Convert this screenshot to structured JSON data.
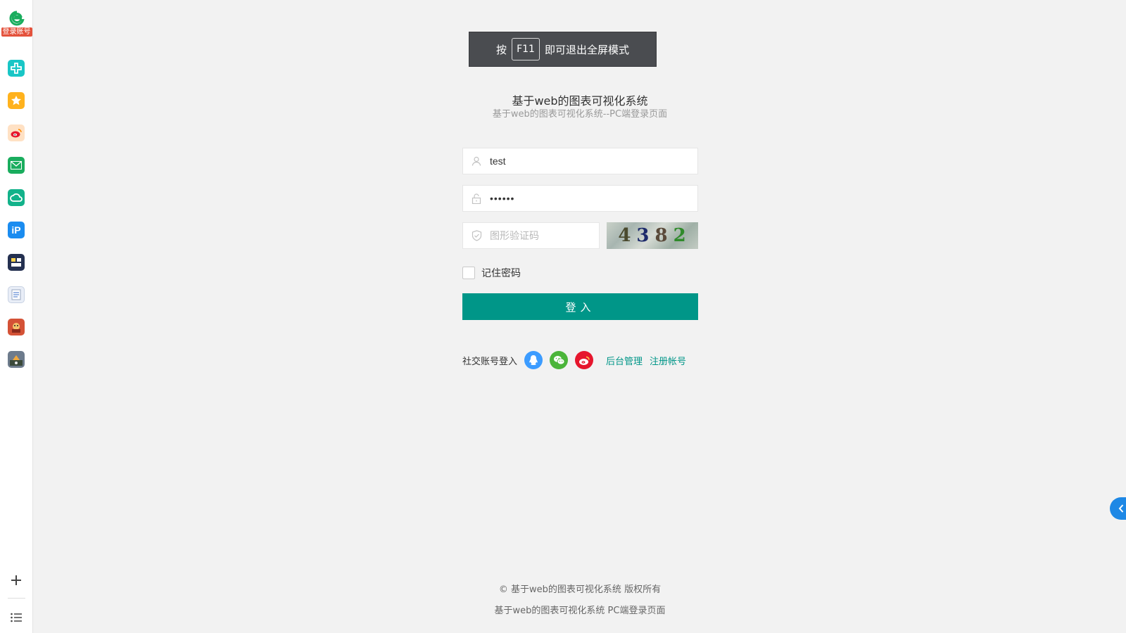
{
  "sidebar": {
    "logo_tag": "登录账号",
    "apps": [
      {
        "icon": "plus-cross-app-icon",
        "color": "#19c6c6"
      },
      {
        "icon": "star-app-icon",
        "color": "#ffb21d"
      },
      {
        "icon": "weibo-app-icon",
        "color": "#ff8a3d"
      },
      {
        "icon": "mail-app-icon",
        "color": "#1aad5e"
      },
      {
        "icon": "cloud-app-icon",
        "color": "#12b28a"
      },
      {
        "icon": "ip-app-icon",
        "color": "#1a8cf0"
      },
      {
        "icon": "news-app-icon",
        "color": "#243050"
      },
      {
        "icon": "word-doc-app-icon",
        "color": "#e9eef7"
      },
      {
        "icon": "game-app-icon",
        "color": "#d45236"
      },
      {
        "icon": "strategy-game-app-icon",
        "color": "#6d7b8c"
      }
    ],
    "add_icon": "plus-icon",
    "menu_icon": "list-icon"
  },
  "fullscreen_hint": {
    "prefix": "按",
    "key": "F11",
    "suffix": "即可退出全屏模式"
  },
  "header": {
    "title": "基于web的图表可视化系统",
    "subtitle": "基于web的图表可视化系统--PC端登录页面"
  },
  "form": {
    "username_value": "test",
    "password_value": "••••••",
    "captcha_placeholder": "图形验证码",
    "captcha_text": [
      "4",
      "3",
      "8",
      "2"
    ],
    "remember_label": "记住密码",
    "login_label": "登入"
  },
  "social": {
    "label": "社交账号登入",
    "admin_link": "后台管理",
    "register_link": "注册帐号"
  },
  "footer": {
    "copyright": "© 基于web的图表可视化系统 版权所有",
    "line2": "基于web的图表可视化系统 PC端登录页面"
  },
  "colors": {
    "accent": "#009688",
    "qq": "#3c9cff",
    "wechat": "#4bb53a",
    "weibo": "#e6162d"
  }
}
